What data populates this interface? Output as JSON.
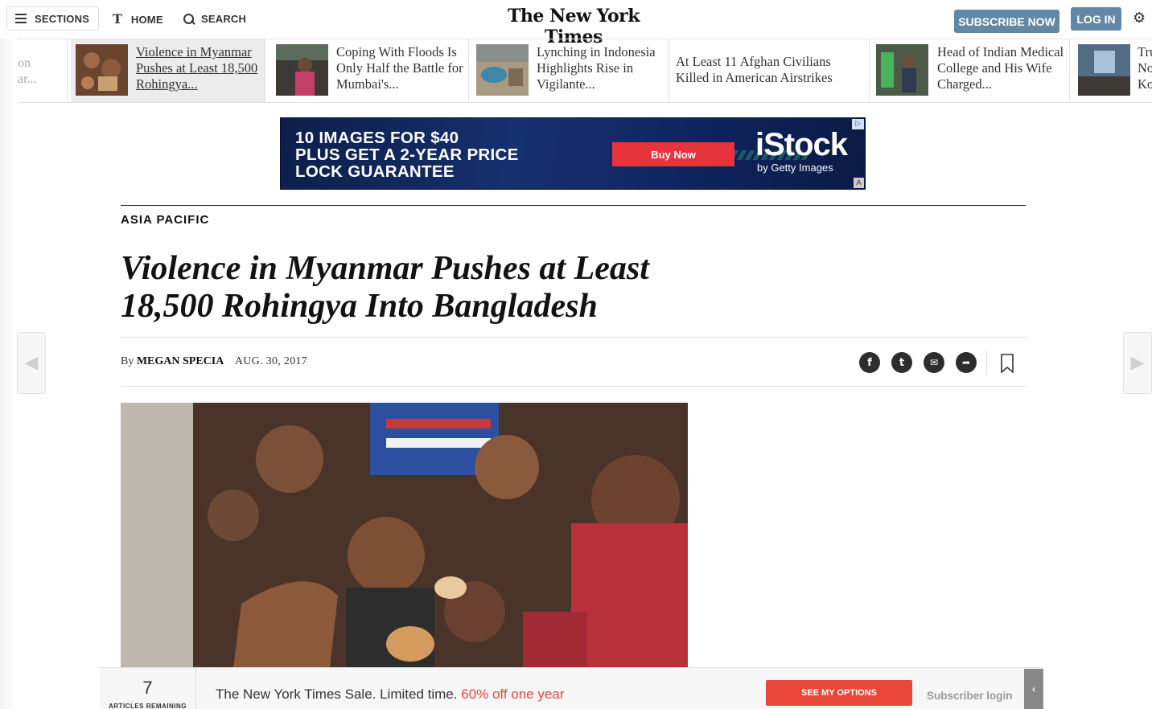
{
  "header": {
    "sections_label": "SECTIONS",
    "home_label": "HOME",
    "search_label": "SEARCH",
    "masthead": "The New York Times",
    "subscribe_label": "SUBSCRIBE NOW",
    "login_label": "LOG IN",
    "t_logo": "T"
  },
  "ribbon": {
    "stub_lines": [
      "on",
      "ar..."
    ],
    "items": [
      {
        "title": "Violence in Myanmar Pushes at Least 18,500 Rohingya...",
        "active": true
      },
      {
        "title": "Coping With Floods Is Only Half the Battle for Mumbai's...",
        "active": false
      },
      {
        "title": "Lynching in Indonesia Highlights Rise in Vigilante...",
        "active": false
      },
      {
        "title": "At Least 11 Afghan Civilians Killed in American Airstrikes",
        "active": false
      },
      {
        "title": "Head of Indian Medical College and His Wife Charged...",
        "active": false
      },
      {
        "title": "Tru No Ko",
        "active": false
      }
    ]
  },
  "ad": {
    "line1": "10 IMAGES FOR $40",
    "line2": "PLUS GET A 2-YEAR PRICE",
    "line3": "LOCK GUARANTEE",
    "button": "Buy Now",
    "brand": "iStock",
    "brand_sub": "by Getty Images",
    "a_badge": "A"
  },
  "article": {
    "section": "ASIA PACIFIC",
    "headline_line1": "Violence in Myanmar Pushes at Least",
    "headline_line2": "18,500 Rohingya Into Bangladesh",
    "by": "By",
    "author": "MEGAN SPECIA",
    "date": "AUG. 30, 2017"
  },
  "share": {
    "facebook": "f",
    "twitter": "t",
    "email": "✉",
    "forward": "➦"
  },
  "banner": {
    "articles_count": "7",
    "articles_label": "ARTICLES REMAINING",
    "sale_text": "The New York Times Sale. Limited time.",
    "sale_highlight": "60% off one year",
    "options_label": "SEE MY OPTIONS",
    "subscriber_login": "Subscriber login"
  },
  "colors": {
    "accent_blue": "#6288a5",
    "sale_red": "#e8473a",
    "ad_red": "#e8333c"
  }
}
